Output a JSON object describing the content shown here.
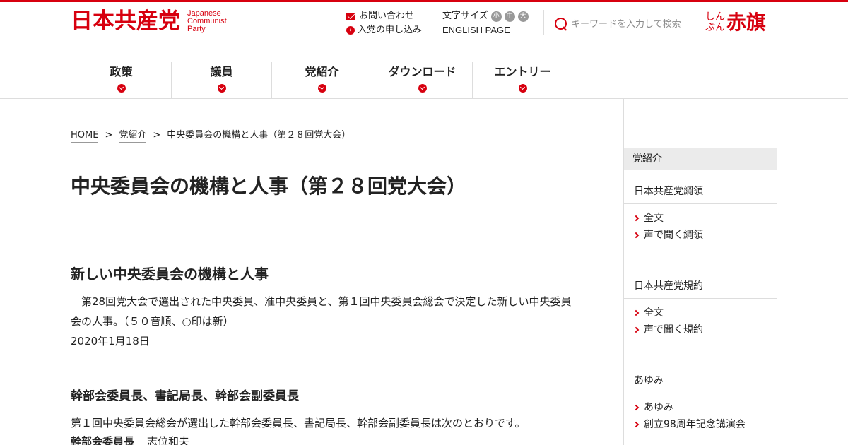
{
  "header": {
    "logo_kanji": "日本共産党",
    "logo_en": [
      "Japanese",
      "Communist",
      "Party"
    ],
    "contact_label": "お問い合わせ",
    "join_label": "入党の申し込み",
    "fontsize_label": "文字サイズ",
    "fontsize_options": [
      "小",
      "中",
      "大"
    ],
    "english_label": "ENGLISH PAGE",
    "search_placeholder": "キーワードを入力して検索",
    "akahata_small": "しんぶん",
    "akahata_big": "赤旗"
  },
  "nav": {
    "items": [
      {
        "label": "政策"
      },
      {
        "label": "議員"
      },
      {
        "label": "党紹介"
      },
      {
        "label": "ダウンロード"
      },
      {
        "label": "エントリー"
      }
    ]
  },
  "breadcrumb": {
    "home": "HOME",
    "sep": ">",
    "parent": "党紹介",
    "current": "中央委員会の機構と人事（第２８回党大会）"
  },
  "main": {
    "title": "中央委員会の機構と人事（第２８回党大会）",
    "section_title": "新しい中央委員会の機構と人事",
    "paragraph": "　第28回党大会で選出された中央委員、准中央委員と、第１回中央委員会総会で決定した新しい中央委員会の人事。（５０音順、○印は新）",
    "date": "2020年1月18日",
    "sub_title": "幹部会委員長、書記局長、幹部会副委員長",
    "paragraph2": "第１回中央委員会総会が選出した幹部会委員長、書記局長、幹部会副委員長は次のとおりです。",
    "leader_role": "幹部会委員長",
    "leader_name": "志位和夫"
  },
  "sidebar": {
    "head": "党紹介",
    "groups": [
      {
        "title": "日本共産党綱領",
        "links": [
          "全文",
          "声で聞く綱領"
        ]
      },
      {
        "title": "日本共産党規約",
        "links": [
          "全文",
          "声で聞く規約"
        ]
      },
      {
        "title": "あゆみ",
        "links": [
          "あゆみ",
          "創立98周年記念講演会"
        ]
      }
    ]
  },
  "colors": {
    "accent": "#d7000f",
    "rule": "#dddddd",
    "sidebar_head_bg": "#ebebeb"
  },
  "icons": [
    "mail-icon",
    "circle-arrow-icon",
    "search-icon",
    "chevron-down-icon",
    "chevron-right-icon"
  ]
}
